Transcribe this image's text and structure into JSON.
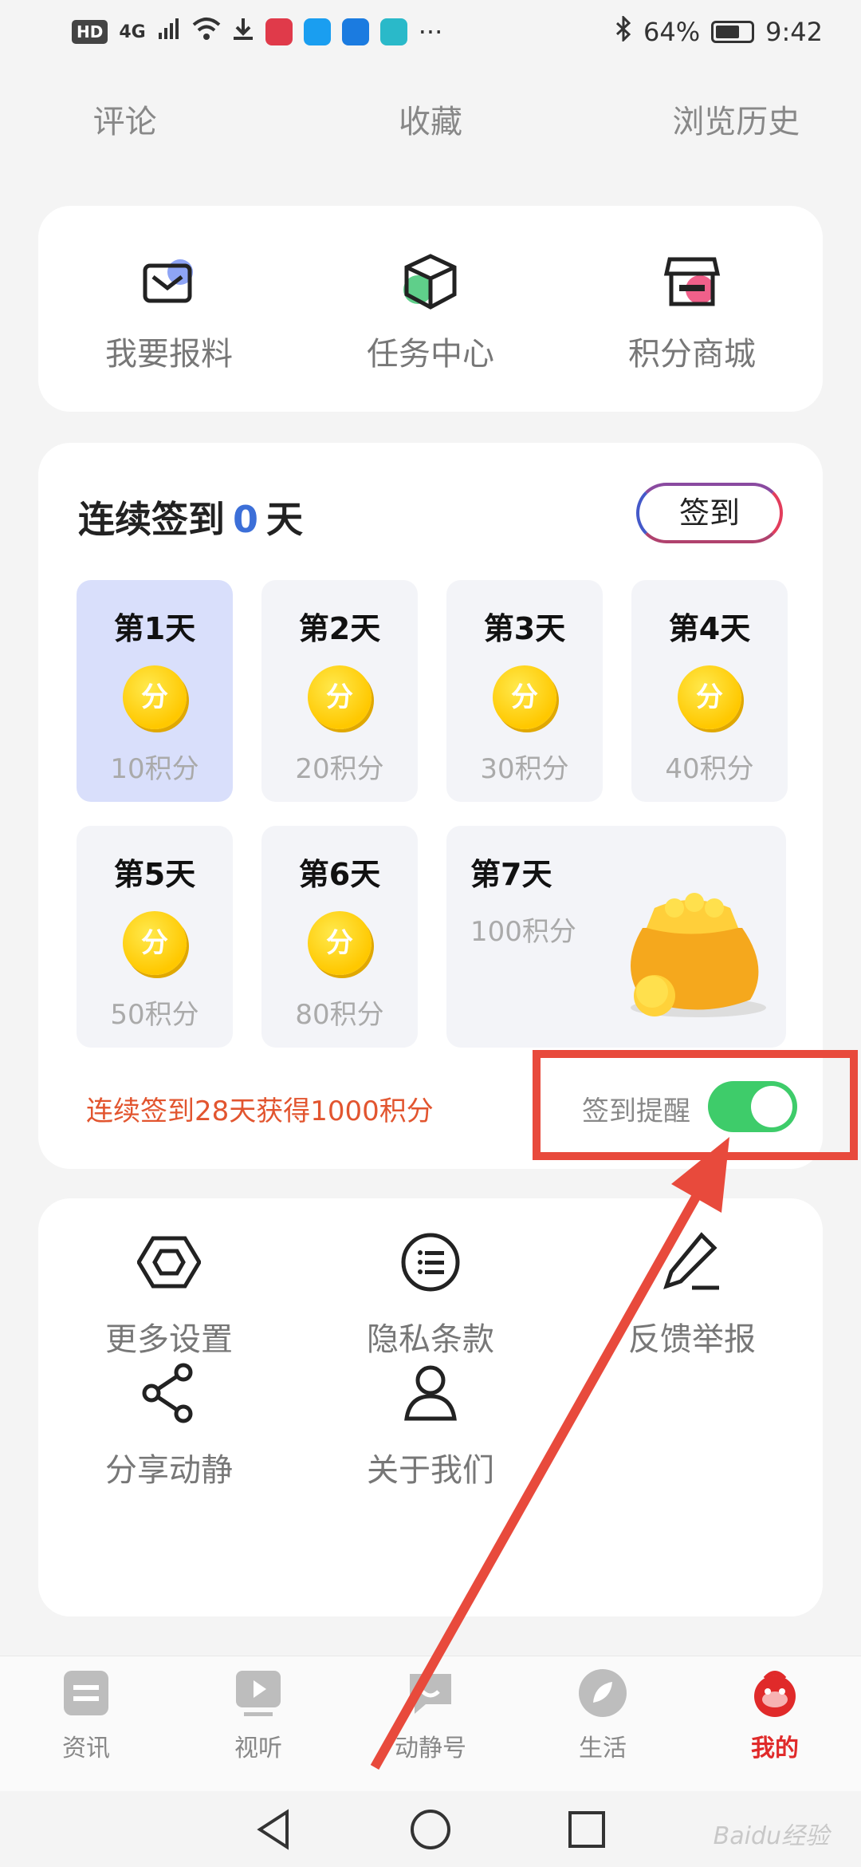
{
  "status_bar": {
    "badge": "HD",
    "network": "4G",
    "more": "···",
    "battery": "64%",
    "time": "9:42"
  },
  "top_links": [
    "评论",
    "收藏",
    "浏览历史"
  ],
  "quick_actions": [
    {
      "label": "我要报料",
      "icon": "mail-icon"
    },
    {
      "label": "任务中心",
      "icon": "box-icon"
    },
    {
      "label": "积分商城",
      "icon": "store-icon"
    }
  ],
  "checkin": {
    "title_prefix": "连续签到",
    "days_count": "0",
    "title_suffix": "天",
    "sign_button": "签到",
    "coin_label": "分",
    "days": [
      {
        "name": "第1天",
        "points": "10积分"
      },
      {
        "name": "第2天",
        "points": "20积分"
      },
      {
        "name": "第3天",
        "points": "30积分"
      },
      {
        "name": "第4天",
        "points": "40积分"
      },
      {
        "name": "第5天",
        "points": "50积分"
      },
      {
        "name": "第6天",
        "points": "80积分"
      },
      {
        "name": "第7天",
        "points": "100积分"
      }
    ],
    "streak_reward": "连续签到28天获得1000积分",
    "reminder_label": "签到提醒",
    "reminder_on": true
  },
  "settings": [
    {
      "label": "更多设置",
      "icon": "hexagon-nut-icon"
    },
    {
      "label": "隐私条款",
      "icon": "list-icon"
    },
    {
      "label": "反馈举报",
      "icon": "pen-icon"
    },
    {
      "label": "分享动静",
      "icon": "share-icon"
    },
    {
      "label": "关于我们",
      "icon": "user-icon"
    }
  ],
  "bottom_nav": [
    {
      "label": "资讯",
      "icon": "news-icon"
    },
    {
      "label": "视听",
      "icon": "video-icon"
    },
    {
      "label": "动静号",
      "icon": "chat-icon"
    },
    {
      "label": "生活",
      "icon": "leaf-icon"
    },
    {
      "label": "我的",
      "icon": "mascot-icon",
      "active": true
    }
  ],
  "watermark": "Baidu经验"
}
